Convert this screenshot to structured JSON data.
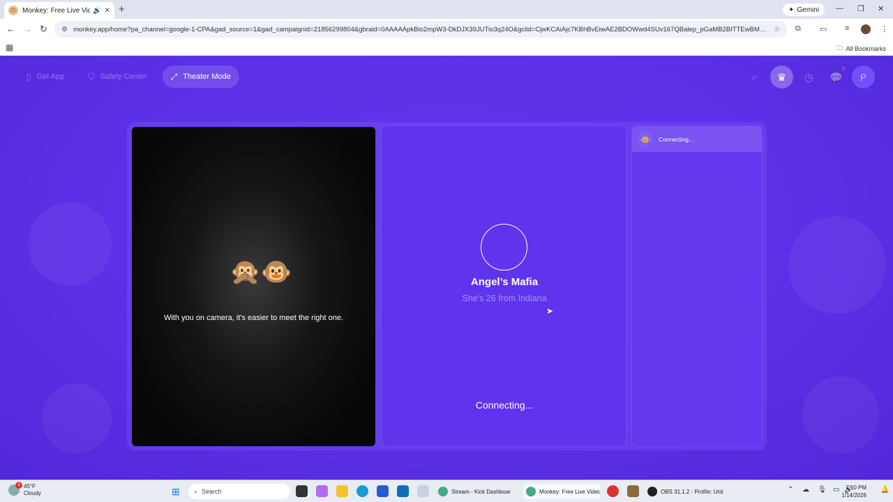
{
  "browser": {
    "tab_title": "Monkey: Free Live Video Ch",
    "new_tab": "+",
    "gemini_label": "Gemini",
    "url": "monkey.app/home?pa_channel=google-1-CPA&gad_source=1&gad_campaignid=21856299804&gbraid=0AAAAApkBio2mpW3-DkDJX39JUTio3q24O&gclid=CjwKCAiAjc7KBhBvEiwAE2BDOWwd4SUv167QBalep_pGaMB2BITTEwBMuFcXR2rS...",
    "all_bookmarks": "All Bookmarks"
  },
  "nav": {
    "get_app": "Get App",
    "safety_center": "Safety Center",
    "theater_mode": "Theater Mode",
    "chat_badge": "2",
    "profile_initial": "P"
  },
  "camera": {
    "message": "With you on camera, it's easier to meet the right one."
  },
  "match": {
    "name": "Angel’s Mafia",
    "subtitle": "She's 26 from Indiana",
    "status": "Connecting..."
  },
  "chat": {
    "status": "Connecting..."
  },
  "taskbar": {
    "weather_temp": "45°F",
    "weather_desc": "Cloudy",
    "weather_badge": "3",
    "search_placeholder": "Search",
    "tasks": [
      {
        "label": "Stream - Kick Dashboar"
      },
      {
        "label": "Monkey: Free Live Vided"
      },
      {
        "label": "OBS 31.1.2 - Profile: Unti"
      }
    ],
    "time": "7:50 PM",
    "date": "1/14/2026"
  }
}
